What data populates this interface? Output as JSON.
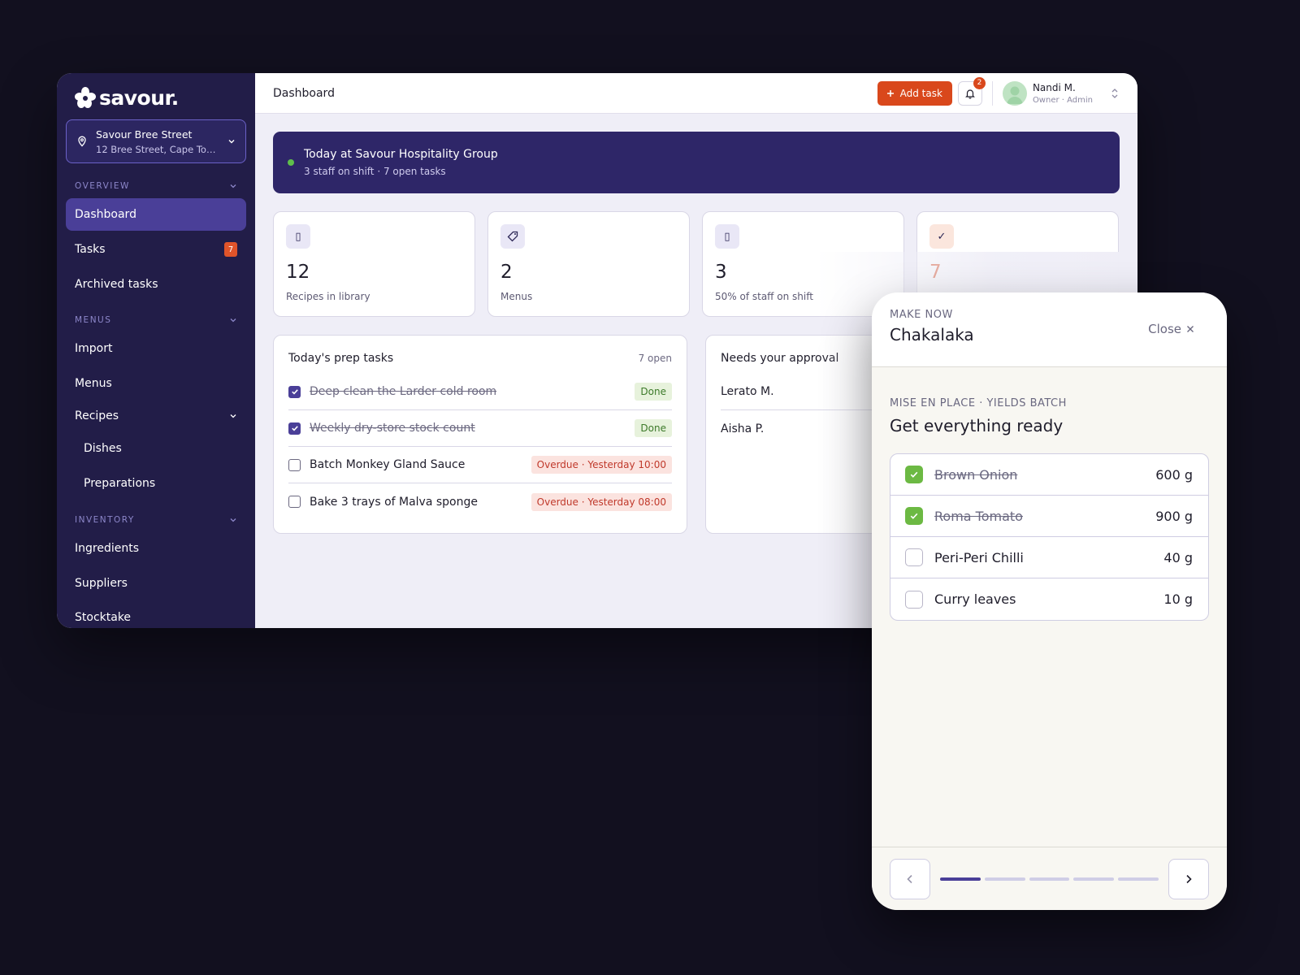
{
  "brand": {
    "name": "savour.",
    "accent": "#4a3f98",
    "brand_orange": "#d9481c",
    "sidebar_bg": "#221d48"
  },
  "location": {
    "name": "Savour Bree Street",
    "address": "12 Bree Street, Cape Town, …"
  },
  "sidebar": {
    "sections": [
      {
        "label": "OVERVIEW",
        "items": [
          {
            "label": "Dashboard",
            "active": true
          },
          {
            "label": "Tasks",
            "badge": "7"
          },
          {
            "label": "Archived tasks"
          }
        ]
      },
      {
        "label": "MENUS",
        "items": [
          {
            "label": "Import"
          },
          {
            "label": "Menus"
          },
          {
            "label": "Recipes",
            "expandable": true
          },
          {
            "label": "Dishes",
            "sub": true
          },
          {
            "label": "Preparations",
            "sub": true
          }
        ]
      },
      {
        "label": "INVENTORY",
        "items": [
          {
            "label": "Ingredients"
          },
          {
            "label": "Suppliers"
          },
          {
            "label": "Stocktake"
          }
        ]
      }
    ]
  },
  "topbar": {
    "title": "Dashboard",
    "add_task_label": "Add task",
    "notifications_count": "2",
    "user": {
      "name": "Nandi M.",
      "role": "Owner · Admin"
    }
  },
  "banner": {
    "title": "Today at Savour Hospitality Group",
    "subtitle": "3 staff on shift · 7 open tasks"
  },
  "stats": [
    {
      "icon": "book-icon",
      "glyph": "▯",
      "value": "12",
      "label": "Recipes in library"
    },
    {
      "icon": "tag-icon",
      "glyph": "◇",
      "value": "2",
      "label": "Menus"
    },
    {
      "icon": "staff-icon",
      "glyph": "▯",
      "value": "3",
      "label": "50% of staff on shift"
    },
    {
      "icon": "check-icon",
      "glyph": "✓",
      "value": "7",
      "label": ""
    }
  ],
  "prep_tasks": {
    "title": "Today's prep tasks",
    "meta": "7 open",
    "items": [
      {
        "text": "Deep clean the Larder cold room",
        "done": true,
        "status": "Done"
      },
      {
        "text": "Weekly dry-store stock count",
        "done": true,
        "status": "Done"
      },
      {
        "text": "Batch Monkey Gland Sauce",
        "done": false,
        "status": "Overdue · Yesterday 10:00"
      },
      {
        "text": "Bake 3 trays of Malva sponge",
        "done": false,
        "status": "Overdue · Yesterday 08:00"
      }
    ]
  },
  "approvals": {
    "title": "Needs your approval",
    "items": [
      {
        "name": "Lerato M."
      },
      {
        "name": "Aisha P."
      }
    ]
  },
  "drawer": {
    "eyebrow": "MAKE NOW",
    "title": "Chakalaka",
    "close_label": "Close",
    "step_eyebrow": "MISE EN PLACE · YIELDS BATCH",
    "step_title": "Get everything ready",
    "ingredients": [
      {
        "name": "Brown Onion",
        "qty": "600 g",
        "checked": true
      },
      {
        "name": "Roma Tomato",
        "qty": "900 g",
        "checked": true
      },
      {
        "name": "Peri-Peri Chilli",
        "qty": "40 g",
        "checked": false
      },
      {
        "name": "Curry leaves",
        "qty": "10 g",
        "checked": false
      }
    ],
    "steps_total": 5,
    "step_current": 1
  }
}
